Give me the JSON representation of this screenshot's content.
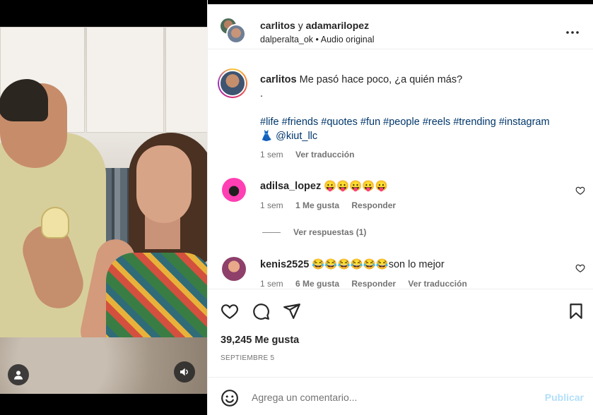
{
  "post": {
    "author_primary": "carlitos",
    "connector": "y",
    "author_secondary": "adamarilopez",
    "audio_user": "dalperalta_ok",
    "separator": "•",
    "audio_label": "Audio original"
  },
  "caption": {
    "username": "carlitos",
    "text": "Me pasó hace poco, ¿a quién más?",
    "dot": ".",
    "hashtags": [
      "#life",
      "#friends",
      "#quotes",
      "#fun",
      "#people",
      "#reels",
      "#trending",
      "#instagram"
    ],
    "mention_emoji": "👗",
    "mention": "@kiut_llc",
    "time": "1 sem",
    "translate": "Ver traducción"
  },
  "comments": [
    {
      "username": "adilsa_lopez",
      "text": "😛😛😛😛😛",
      "time": "1 sem",
      "likes": "1 Me gusta",
      "reply": "Responder",
      "view_replies": "Ver respuestas (1)"
    },
    {
      "username": "kenis2525",
      "text": "😂😂😂😂😂😂son lo mejor",
      "time": "1 sem",
      "likes": "6 Me gusta",
      "reply": "Responder",
      "translate": "Ver traducción"
    }
  ],
  "stats": {
    "likes": "39,245 Me gusta",
    "date": "SEPTIEMBRE 5"
  },
  "composer": {
    "placeholder": "Agrega un comentario...",
    "publish_label": "Publicar"
  },
  "colors": {
    "link": "#00376b",
    "publish_disabled": "#b2dffc",
    "secondary_text": "#737373"
  }
}
